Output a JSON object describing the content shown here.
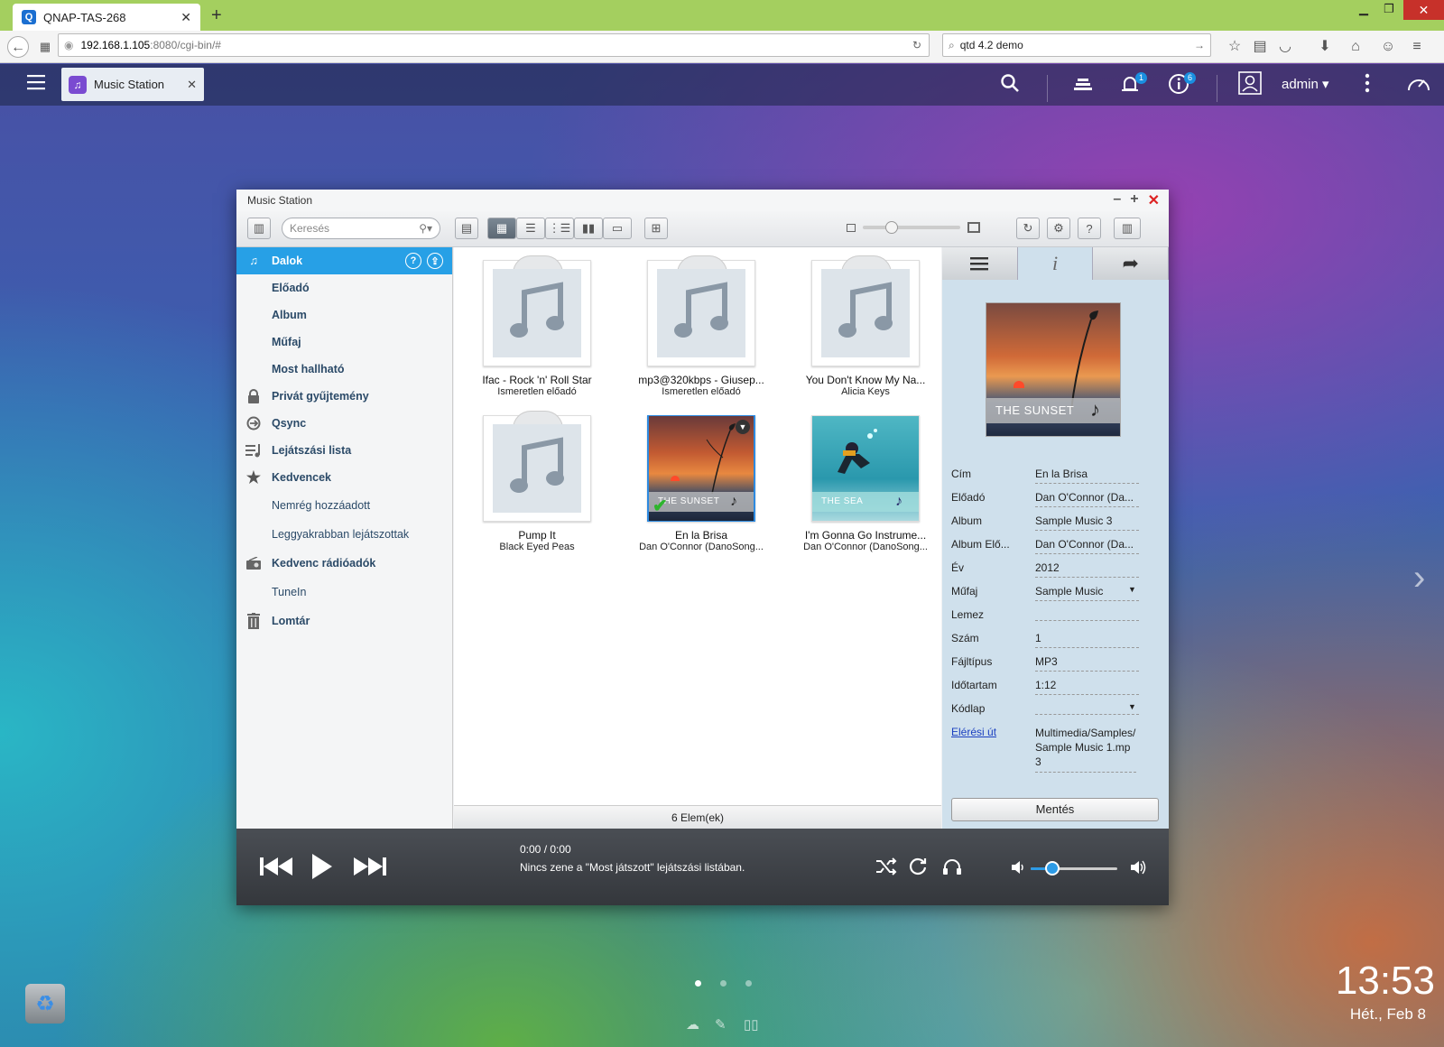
{
  "browser": {
    "tab_title": "QNAP-TAS-268",
    "url_host": "192.168.1.105",
    "url_rest": ":8080/cgi-bin/#",
    "search_value": "qtd 4.2 demo"
  },
  "topbar": {
    "app_tab_label": "Music Station",
    "notification_badge": "1",
    "info_badge": "6",
    "user_label": "admin"
  },
  "window": {
    "title": "Music Station",
    "search_placeholder": "Keresés"
  },
  "sidebar": {
    "items": [
      {
        "label": "Dalok",
        "icon": "music-note-icon"
      },
      {
        "label": "Előadó"
      },
      {
        "label": "Album"
      },
      {
        "label": "Műfaj"
      },
      {
        "label": "Most hallható"
      },
      {
        "label": "Privát gyűjtemény",
        "icon": "lock-icon"
      },
      {
        "label": "Qsync",
        "icon": "qsync-icon"
      },
      {
        "label": "Lejátszási lista",
        "icon": "playlist-icon"
      },
      {
        "label": "Kedvencek",
        "icon": "star-icon"
      },
      {
        "label": "Nemrég hozzáadott"
      },
      {
        "label": "Leggyakrabban lejátszottak"
      },
      {
        "label": "Kedvenc rádióadók",
        "icon": "radio-icon"
      },
      {
        "label": "TuneIn"
      },
      {
        "label": "Lomtár",
        "icon": "trash-icon"
      }
    ]
  },
  "songs": [
    {
      "title": "Ifac - Rock 'n' Roll Star",
      "artist": "Ismeretlen előadó",
      "art": "placeholder"
    },
    {
      "title": "mp3@320kbps - Giusep...",
      "artist": "Ismeretlen előadó",
      "art": "placeholder"
    },
    {
      "title": "You Don't Know My Na...",
      "artist": "Alicia Keys",
      "art": "placeholder"
    },
    {
      "title": "Pump It",
      "artist": "Black Eyed Peas",
      "art": "placeholder"
    },
    {
      "title": "En la Brisa",
      "artist": "Dan O'Connor (DanoSong...",
      "art": "sunset",
      "art_label": "THE SUNSET",
      "selected": true
    },
    {
      "title": "I'm Gonna Go Instrume...",
      "artist": "Dan O'Connor (DanoSong...",
      "art": "sea",
      "art_label": "THE SEA"
    }
  ],
  "status": "6 Elem(ek)",
  "details": {
    "cover_label": "THE SUNSET",
    "fields": [
      {
        "key": "Cím",
        "value": "En la Brisa"
      },
      {
        "key": "Előadó",
        "value": "Dan O'Connor (Da..."
      },
      {
        "key": "Album",
        "value": "Sample Music 3"
      },
      {
        "key": "Album Elő...",
        "value": "Dan O'Connor (Da..."
      },
      {
        "key": "Év",
        "value": "2012"
      },
      {
        "key": "Műfaj",
        "value": "Sample Music"
      },
      {
        "key": "Lemez",
        "value": ""
      },
      {
        "key": "Szám",
        "value": "1"
      },
      {
        "key": "Fájltípus",
        "value": "MP3"
      },
      {
        "key": "Időtartam",
        "value": "1:12"
      },
      {
        "key": "Kódlap",
        "value": ""
      },
      {
        "key": "Elérési út",
        "value": "Multimedia/Samples/Sample Music 1.mp3"
      }
    ],
    "save_label": "Mentés"
  },
  "player": {
    "time": "0:00 / 0:00",
    "message": "Nincs zene a \"Most játszott\" lejátszási listában.",
    "volume_level": 0.25
  },
  "desktop": {
    "clock": "13:53",
    "date": "Hét., Feb 8"
  },
  "colors": {
    "accent": "#27a0e6",
    "browser_tabbar": "#a4cf5f",
    "close_red": "#c7312a"
  }
}
